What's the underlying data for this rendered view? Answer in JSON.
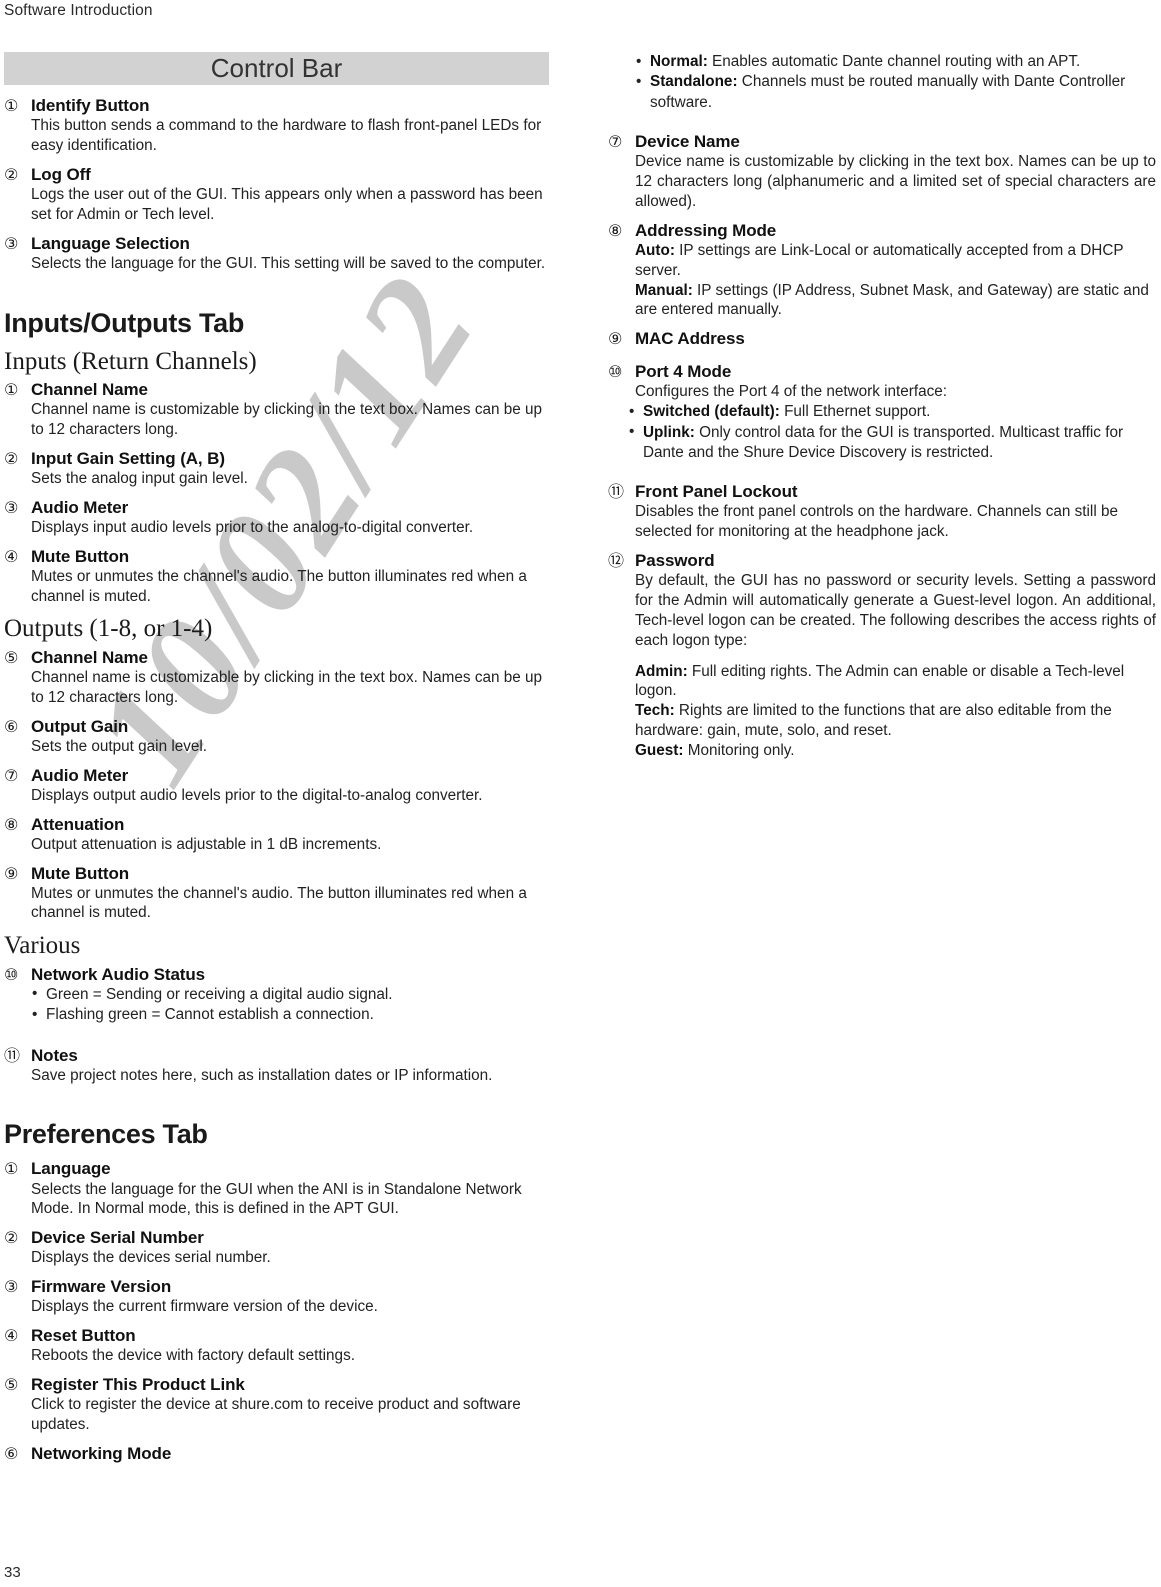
{
  "page": {
    "running_header": "Software Introduction",
    "page_number": "33",
    "watermark": "10/02/12"
  },
  "left_column": {
    "control_bar": {
      "bar_title": "Control Bar",
      "entries": [
        {
          "num": "①",
          "title": "Identify Button",
          "body": "This button sends a command to the hardware to flash front-panel LEDs for easy identification."
        },
        {
          "num": "②",
          "title": "Log Off",
          "body": "Logs the user out of the GUI. This appears only when a password has been set for Admin or Tech level."
        },
        {
          "num": "③",
          "title": "Language Selection",
          "body": "Selects the language for the GUI. This setting will be saved to the computer."
        }
      ]
    },
    "inputs_outputs_tab": {
      "heading": "Inputs/Outputs Tab",
      "inputs_heading": "Inputs (Return Channels)",
      "inputs_entries": [
        {
          "num": "①",
          "title": "Channel Name",
          "body": "Channel name is customizable by clicking in the text box. Names can be up to 12 characters long."
        },
        {
          "num": "②",
          "title": "Input Gain Setting (A, B)",
          "body": "Sets the analog input gain level."
        },
        {
          "num": "③",
          "title": "Audio Meter",
          "body": "Displays input audio levels prior to the analog-to-digital converter."
        },
        {
          "num": "④",
          "title": "Mute Button",
          "body": "Mutes or unmutes the channel's audio. The button illuminates red when a channel is muted."
        }
      ],
      "outputs_heading": "Outputs (1-8, or 1-4)",
      "outputs_entries": [
        {
          "num": "⑤",
          "title": "Channel Name",
          "body": "Channel name is customizable by clicking in the text box. Names can be up to 12 characters long."
        },
        {
          "num": "⑥",
          "title": "Output Gain",
          "body": "Sets the output gain level."
        },
        {
          "num": "⑦",
          "title": "Audio Meter",
          "body": "Displays output audio levels prior to the digital-to-analog converter."
        },
        {
          "num": "⑧",
          "title": "Attenuation",
          "body": "Output attenuation is adjustable in 1 dB increments."
        },
        {
          "num": "⑨",
          "title": "Mute Button",
          "body": "Mutes or unmutes the channel's audio. The button illuminates red when a channel is muted."
        }
      ],
      "various_heading": "Various",
      "network_audio_status": {
        "num": "⑩",
        "title": "Network Audio Status",
        "bullets": [
          "Green = Sending or receiving a digital audio signal.",
          "Flashing green = Cannot establish a connection."
        ]
      },
      "notes": {
        "num": "⑪",
        "title": "Notes",
        "body": "Save project notes here, such as installation dates or IP information."
      }
    },
    "preferences_tab": {
      "heading": "Preferences Tab",
      "entries": [
        {
          "num": "①",
          "title": "Language",
          "body": "Selects the language for the GUI when the ANI is in Standalone Network Mode. In Normal mode, this is defined in the APT GUI."
        },
        {
          "num": "②",
          "title": "Device Serial Number",
          "body": "Displays the devices serial number."
        },
        {
          "num": "③",
          "title": "Firmware Version",
          "body": "Displays the current firmware version of the device."
        },
        {
          "num": "④",
          "title": "Reset Button",
          "body": "Reboots the device with factory default settings."
        },
        {
          "num": "⑤",
          "title": "Register This Product Link",
          "body": "Click to register the device at shure.com to receive product and software updates."
        },
        {
          "num": "⑥",
          "title": "Networking Mode",
          "body": ""
        }
      ]
    }
  },
  "right_column": {
    "networking_mode_bullets": [
      {
        "label": "Normal:",
        "text": " Enables automatic Dante channel routing with an APT."
      },
      {
        "label": "Standalone:",
        "text": " Channels must be routed manually with Dante Controller software."
      }
    ],
    "device_name": {
      "num": "⑦",
      "title": "Device Name",
      "body": "Device name is customizable by clicking in the text box. Names can be up to 12 characters long (alphanumeric and a limited set of special characters are allowed)."
    },
    "addressing_mode": {
      "num": "⑧",
      "title": "Addressing Mode",
      "auto_label": "Auto:",
      "auto_text": " IP settings are Link-Local or automatically accepted from a DHCP server.",
      "manual_label": "Manual:",
      "manual_text": " IP settings (IP Address, Subnet Mask, and Gateway) are static and are entered manually."
    },
    "mac_address": {
      "num": "⑨",
      "title": "MAC Address"
    },
    "port4_mode": {
      "num": "⑩",
      "title": "Port 4 Mode",
      "intro": "Configures the Port 4 of the network interface:",
      "bullets": [
        {
          "label": "Switched (default):",
          "text": " Full Ethernet support."
        },
        {
          "label": "Uplink:",
          "text": " Only control data for the GUI is transported. Multicast traffic for Dante and the Shure Device Discovery is restricted."
        }
      ]
    },
    "front_panel_lockout": {
      "num": "⑪",
      "title": "Front Panel Lockout",
      "body": "Disables the front panel controls on the hardware. Channels can still be selected for monitoring at the headphone jack."
    },
    "password": {
      "num": "⑫",
      "title": "Password",
      "intro": "By default, the GUI has no password or security levels. Setting a password for the Admin will automatically generate a Guest-level logon. An additional, Tech-level logon can be created. The following describes the access rights of each logon type:",
      "admin_label": "Admin:",
      "admin_text": " Full editing rights. The Admin can enable or disable a Tech-level logon.",
      "tech_label": "Tech:",
      "tech_text": " Rights are limited to the functions that are also editable from the hardware: gain, mute, solo, and reset.",
      "guest_label": "Guest:",
      "guest_text": " Monitoring only."
    }
  }
}
